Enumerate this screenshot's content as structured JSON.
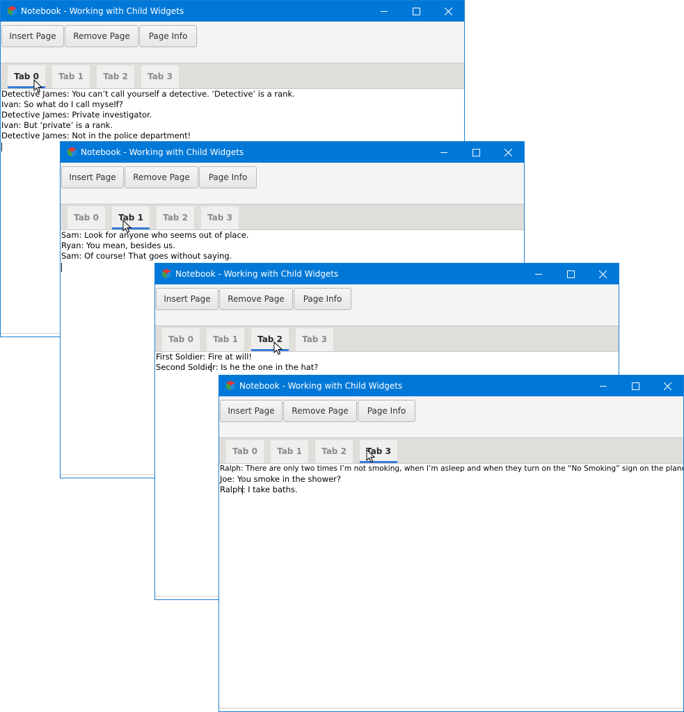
{
  "windows": [
    {
      "title": "Notebook - Working with Child Widgets",
      "buttons": {
        "insert": "Insert Page",
        "remove": "Remove Page",
        "info": "Page Info"
      },
      "tabs": [
        "Tab 0",
        "Tab 1",
        "Tab 2",
        "Tab 3"
      ],
      "selected_tab": 0,
      "lines": [
        "Detective James: You can’t call yourself a detective. ‘Detective’ is a rank.",
        "Ivan: So what do I call myself?",
        "Detective James: Private investigator.",
        "Ivan: But ‘private’ is a rank.",
        "Detective James: Not in the police department!"
      ]
    },
    {
      "title": "Notebook - Working with Child Widgets",
      "buttons": {
        "insert": "Insert Page",
        "remove": "Remove Page",
        "info": "Page Info"
      },
      "tabs": [
        "Tab 0",
        "Tab 1",
        "Tab 2",
        "Tab 3"
      ],
      "selected_tab": 1,
      "lines": [
        "Sam: Look for anyone who seems out of place.",
        "Ryan: You mean, besides us.",
        "Sam: Of course! That goes without saying."
      ]
    },
    {
      "title": "Notebook - Working with Child Widgets",
      "buttons": {
        "insert": "Insert Page",
        "remove": "Remove Page",
        "info": "Page Info"
      },
      "tabs": [
        "Tab 0",
        "Tab 1",
        "Tab 2",
        "Tab 3"
      ],
      "selected_tab": 2,
      "lines": [
        "First Soldier: Fire at will!",
        "Second Soldier: Is he the one in the hat?"
      ]
    },
    {
      "title": "Notebook - Working with Child Widgets",
      "buttons": {
        "insert": "Insert Page",
        "remove": "Remove Page",
        "info": "Page Info"
      },
      "tabs": [
        "Tab 0",
        "Tab 1",
        "Tab 2",
        "Tab 3"
      ],
      "selected_tab": 3,
      "lines": [
        "Ralph: There are only two times I’m not smoking, when I’m asleep and when they turn on the “No Smoking” sign on the plane.",
        "Joe: You smoke in the shower?",
        "Ralph: I take baths."
      ]
    }
  ],
  "colors": {
    "titlebar": "#0078d7",
    "tab_indicator": "#3a7bd5",
    "tabbar": "#e0dedb"
  },
  "icons": {
    "app": "notebook-app-icon",
    "minimize": "minimize-icon",
    "maximize": "maximize-icon",
    "close": "close-icon",
    "cursor": "mouse-pointer-icon"
  }
}
